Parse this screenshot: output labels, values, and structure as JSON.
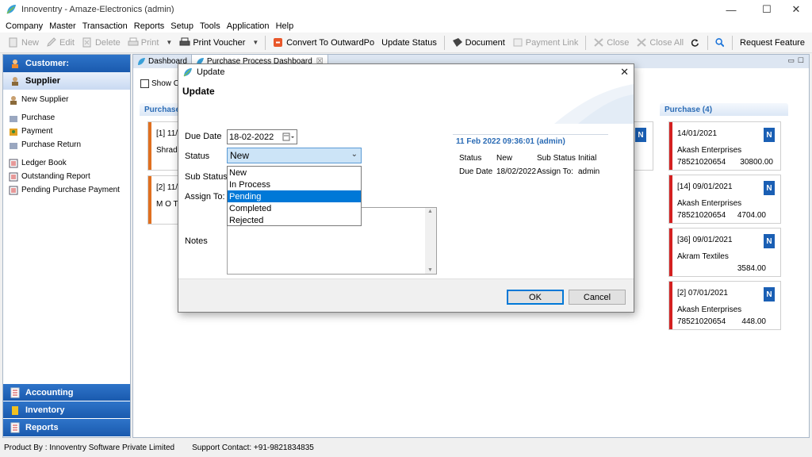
{
  "window": {
    "title": "Innoventry - Amaze-Electronics (admin)",
    "controls": {
      "minimize": "—",
      "maximize": "☐",
      "close": "✕"
    }
  },
  "menu": [
    "Company",
    "Master",
    "Transaction",
    "Reports",
    "Setup",
    "Tools",
    "Application",
    "Help"
  ],
  "toolbar": {
    "new": "New",
    "edit": "Edit",
    "delete": "Delete",
    "print": "Print",
    "print_voucher": "Print Voucher",
    "convert": "Convert To OutwardPo",
    "update_status": "Update Status",
    "document": "Document",
    "payment_link": "Payment Link",
    "close": "Close",
    "close_all": "Close All",
    "request_feature": "Request Feature"
  },
  "sidebar": {
    "customer": "Customer:",
    "supplier": "Supplier",
    "items": [
      "New Supplier",
      "Purchase",
      "Payment",
      "Purchase Return",
      "Ledger Book",
      "Outstanding Report",
      "Pending Purchase Payment"
    ],
    "accounting": "Accounting",
    "inventory": "Inventory",
    "reports": "Reports"
  },
  "tabs": [
    {
      "label": "Dashboard"
    },
    {
      "label": "Purchase Process Dashboard",
      "close": "☒"
    }
  ],
  "main": {
    "show_checkbox_label": "Show Cl",
    "left_col_header": "Purchase",
    "left_cards": [
      {
        "line1": "[1] 11/",
        "line2": "Shradd"
      },
      {
        "line1": "[2] 11/",
        "line2": "M O T"
      }
    ],
    "right_col_header": "Purchase (4)",
    "right_cards": [
      {
        "line1": "14/01/2021",
        "party": "Akash Enterprises",
        "phone": "78521020654",
        "amount": "30800.00",
        "badge": "N",
        "bar": "#d42020"
      },
      {
        "line1": "[14]  09/01/2021",
        "party": "Akash Enterprises",
        "phone": "78521020654",
        "amount": "4704.00",
        "badge": "N",
        "bar": "#d42020"
      },
      {
        "line1": "[36]  09/01/2021",
        "party": "Akram Textiles",
        "phone": "",
        "amount": "3584.00",
        "badge": "N",
        "bar": "#d42020"
      },
      {
        "line1": "[2]  07/01/2021",
        "party": "Akash Enterprises",
        "phone": "78521020654",
        "amount": "448.00",
        "badge": "N",
        "bar": "#d42020"
      }
    ],
    "mid_badge": "N"
  },
  "dialog": {
    "title": "Update",
    "heading": "Update",
    "due_date_label": "Due Date",
    "due_date_value": "18-02-2022",
    "status_label": "Status",
    "status_value": "New",
    "sub_status_label": "Sub Status",
    "assign_to_label": "Assign To:",
    "notes_label": "Notes",
    "status_options": [
      "New",
      "In Process",
      "Pending",
      "Completed",
      "Rejected"
    ],
    "highlighted_option": "Pending",
    "info": {
      "header": "11 Feb 2022 09:36:01 (admin)",
      "status_label": "Status",
      "status_value": "New",
      "sub_status_label": "Sub Status",
      "sub_status_value": "Initial",
      "due_date_label": "Due Date",
      "due_date_value": "18/02/2022",
      "assign_to_label": "Assign To:",
      "assign_to_value": "admin"
    },
    "ok": "OK",
    "cancel": "Cancel"
  },
  "statusbar": {
    "product_by": "Product By : Innoventry Software Private Limited",
    "support": "Support Contact: +91-9821834835"
  },
  "colors": {
    "accent_blue": "#1a5aae",
    "card_bar_orange": "#e07020",
    "card_bar_red": "#d42020",
    "selection": "#0078d7"
  }
}
